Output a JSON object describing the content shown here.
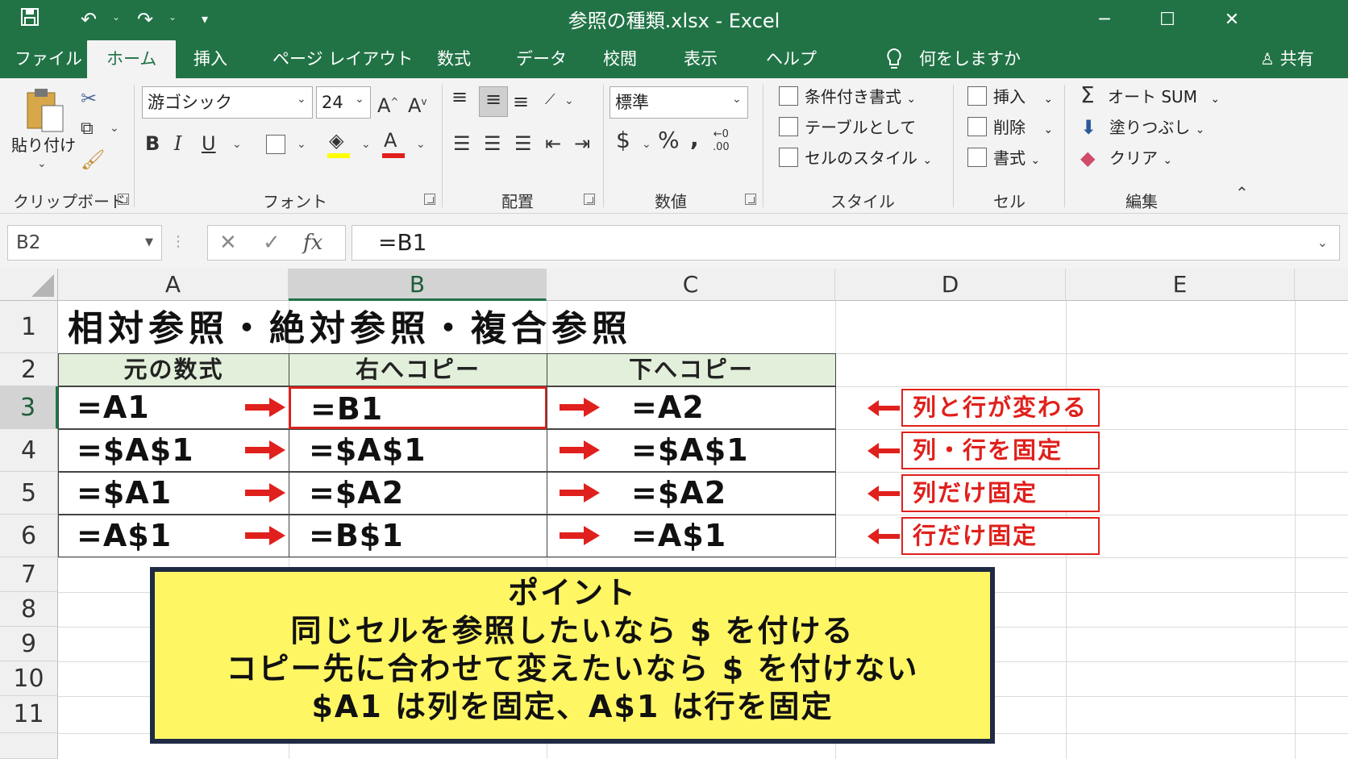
{
  "window": {
    "title": "参照の種類.xlsx - Excel"
  },
  "tabs": [
    "ファイル",
    "ホーム",
    "挿入",
    "ページ レイアウト",
    "数式",
    "データ",
    "校閲",
    "表示",
    "ヘルプ"
  ],
  "active_tab": "ホーム",
  "tell_me": "何をしますか",
  "share": "共有",
  "ribbon": {
    "clipboard": {
      "paste": "貼り付け",
      "label": "クリップボード"
    },
    "font": {
      "name": "游ゴシック",
      "size": "24",
      "label": "フォント",
      "bold": "B",
      "italic": "I",
      "underline": "U"
    },
    "alignment": {
      "label": "配置"
    },
    "number": {
      "format": "標準",
      "currency": "$",
      "percent": "%",
      "comma": ",",
      "label": "数値"
    },
    "styles": {
      "conditional": "条件付き書式",
      "table": "テーブルとして",
      "cell_styles": "セルのスタイル",
      "label": "スタイル"
    },
    "cells": {
      "insert": "挿入",
      "delete": "削除",
      "format": "書式",
      "label": "セル"
    },
    "editing": {
      "autosum": "オート SUM",
      "fill": "塗りつぶし",
      "clear": "クリア",
      "label": "編集"
    }
  },
  "formula_bar": {
    "name_box": "B2",
    "fx": "fx",
    "formula": "=B1"
  },
  "sheet": {
    "columns": [
      "A",
      "B",
      "C",
      "D",
      "E"
    ],
    "rows": [
      "1",
      "2",
      "3",
      "4",
      "5",
      "6",
      "7",
      "8",
      "9",
      "10",
      "11"
    ],
    "title": "相対参照・絶対参照・複合参照",
    "headers": [
      "元の数式",
      "右へコピー",
      "下へコピー"
    ],
    "data_rows": [
      {
        "a": "=A1",
        "b": "=B1",
        "c": "=A2",
        "note": "列と行が変わる"
      },
      {
        "a": "=$A$1",
        "b": "=$A$1",
        "c": "=$A$1",
        "note": "列・行を固定"
      },
      {
        "a": "=$A1",
        "b": "=$A2",
        "c": "=$A2",
        "note": "列だけ固定"
      },
      {
        "a": "=A$1",
        "b": "=B$1",
        "c": "=A$1",
        "note": "行だけ固定"
      }
    ],
    "point_box": [
      "ポイント",
      "同じセルを参照したいなら $ を付ける",
      "コピー先に合わせて変えたいなら $ を付けない",
      "$A1 は列を固定、A$1 は行を固定"
    ]
  },
  "colors": {
    "excel_green": "#217346",
    "arrow_red": "#e0201c",
    "header_fill": "#e2efda",
    "point_fill": "#fff664"
  }
}
